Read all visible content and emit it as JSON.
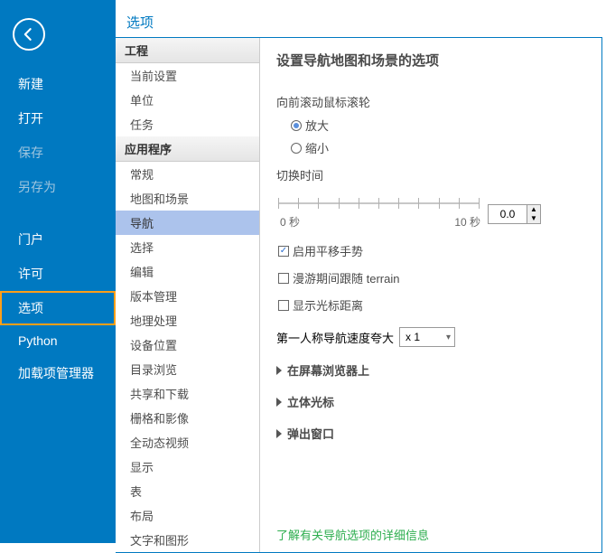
{
  "mainTitle": "选项",
  "sidebar": {
    "items": [
      {
        "label": "新建",
        "disabled": false
      },
      {
        "label": "打开",
        "disabled": false
      },
      {
        "label": "保存",
        "disabled": true
      },
      {
        "label": "另存为",
        "disabled": true
      }
    ],
    "items2": [
      {
        "label": "门户",
        "disabled": false
      },
      {
        "label": "许可",
        "disabled": false
      },
      {
        "label": "选项",
        "disabled": false,
        "selected": true
      },
      {
        "label": "Python",
        "disabled": false
      },
      {
        "label": "加载项管理器",
        "disabled": false
      }
    ]
  },
  "tree": {
    "groups": [
      {
        "title": "工程",
        "items": [
          "当前设置",
          "单位",
          "任务"
        ]
      },
      {
        "title": "应用程序",
        "items": [
          "常规",
          "地图和场景",
          "导航",
          "选择",
          "编辑",
          "版本管理",
          "地理处理",
          "设备位置",
          "目录浏览",
          "共享和下载",
          "栅格和影像",
          "全动态视频",
          "显示",
          "表",
          "布局",
          "文字和图形"
        ]
      }
    ],
    "active": "导航"
  },
  "content": {
    "heading": "设置导航地图和场景的选项",
    "scrollLabel": "向前滚动鼠标滚轮",
    "zoomIn": "放大",
    "zoomOut": "缩小",
    "switchTime": "切换时间",
    "sliderMin": "0 秒",
    "sliderMax": "10 秒",
    "spinValue": "0.0",
    "chkPan": "启用平移手势",
    "chkRoam": "漫游期间跟随 terrain",
    "chkCursor": "显示光标距离",
    "fpLabel": "第一人称导航速度夸大",
    "fpValue": "x 1",
    "exp1": "在屏幕浏览器上",
    "exp2": "立体光标",
    "exp3": "弹出窗口",
    "helpLink": "了解有关导航选项的详细信息"
  }
}
